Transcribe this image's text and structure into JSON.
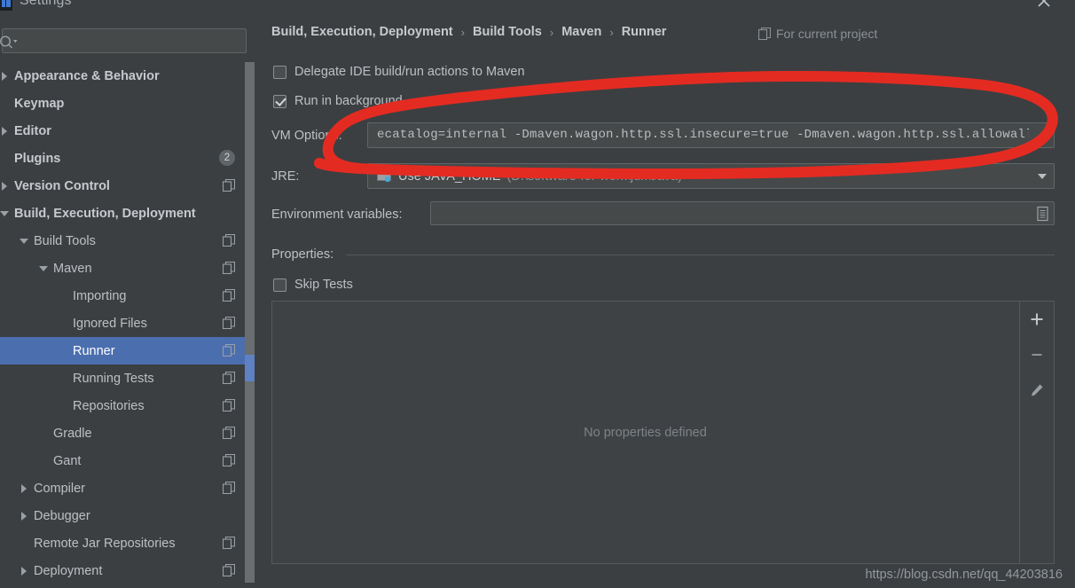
{
  "window": {
    "title": "Settings",
    "close_label": "×",
    "app_icon": "intellij-logo-icon"
  },
  "search": {
    "value": "",
    "placeholder": ""
  },
  "sidebar": {
    "items": [
      {
        "label": "Appearance & Behavior",
        "indent": 0,
        "arrow": "right",
        "bold": true,
        "badge": null,
        "copy": false,
        "selected": false
      },
      {
        "label": "Keymap",
        "indent": 0,
        "arrow": "none",
        "bold": true,
        "badge": null,
        "copy": false,
        "selected": false
      },
      {
        "label": "Editor",
        "indent": 0,
        "arrow": "right",
        "bold": true,
        "badge": null,
        "copy": false,
        "selected": false
      },
      {
        "label": "Plugins",
        "indent": 0,
        "arrow": "none",
        "bold": true,
        "badge": "2",
        "copy": false,
        "selected": false
      },
      {
        "label": "Version Control",
        "indent": 0,
        "arrow": "right",
        "bold": true,
        "badge": null,
        "copy": true,
        "selected": false
      },
      {
        "label": "Build, Execution, Deployment",
        "indent": 0,
        "arrow": "down",
        "bold": true,
        "badge": null,
        "copy": false,
        "selected": false
      },
      {
        "label": "Build Tools",
        "indent": 1,
        "arrow": "down",
        "bold": false,
        "badge": null,
        "copy": true,
        "selected": false
      },
      {
        "label": "Maven",
        "indent": 2,
        "arrow": "down",
        "bold": false,
        "badge": null,
        "copy": true,
        "selected": false
      },
      {
        "label": "Importing",
        "indent": 3,
        "arrow": "none",
        "bold": false,
        "badge": null,
        "copy": true,
        "selected": false
      },
      {
        "label": "Ignored Files",
        "indent": 3,
        "arrow": "none",
        "bold": false,
        "badge": null,
        "copy": true,
        "selected": false
      },
      {
        "label": "Runner",
        "indent": 3,
        "arrow": "none",
        "bold": false,
        "badge": null,
        "copy": true,
        "selected": true
      },
      {
        "label": "Running Tests",
        "indent": 3,
        "arrow": "none",
        "bold": false,
        "badge": null,
        "copy": true,
        "selected": false
      },
      {
        "label": "Repositories",
        "indent": 3,
        "arrow": "none",
        "bold": false,
        "badge": null,
        "copy": true,
        "selected": false
      },
      {
        "label": "Gradle",
        "indent": 2,
        "arrow": "none",
        "bold": false,
        "badge": null,
        "copy": true,
        "selected": false
      },
      {
        "label": "Gant",
        "indent": 2,
        "arrow": "none",
        "bold": false,
        "badge": null,
        "copy": true,
        "selected": false
      },
      {
        "label": "Compiler",
        "indent": 1,
        "arrow": "right",
        "bold": false,
        "badge": null,
        "copy": true,
        "selected": false
      },
      {
        "label": "Debugger",
        "indent": 1,
        "arrow": "right",
        "bold": false,
        "badge": null,
        "copy": false,
        "selected": false
      },
      {
        "label": "Remote Jar Repositories",
        "indent": 1,
        "arrow": "none",
        "bold": false,
        "badge": null,
        "copy": true,
        "selected": false
      },
      {
        "label": "Deployment",
        "indent": 1,
        "arrow": "right",
        "bold": false,
        "badge": null,
        "copy": true,
        "selected": false
      }
    ]
  },
  "breadcrumb": {
    "crumbs": [
      "Build, Execution, Deployment",
      "Build Tools",
      "Maven",
      "Runner"
    ],
    "separator": "›",
    "scope_label": "For current project"
  },
  "form": {
    "delegate_label": "Delegate IDE build/run actions to Maven",
    "delegate_checked": false,
    "run_background_label": "Run in background",
    "run_background_checked": true,
    "vm_options_label": "VM Options:",
    "vm_options_value": "ecatalog=internal -Dmaven.wagon.http.ssl.insecure=true -Dmaven.wagon.http.ssl.allowall=true",
    "jre_label": "JRE:",
    "jre_value": "Use JAVA_HOME",
    "jre_path": "(D:\\software-for-work\\jdk\\Java)",
    "env_label": "Environment variables:",
    "env_value": "",
    "properties_label": "Properties:",
    "skip_tests_label": "Skip Tests",
    "skip_tests_checked": false,
    "properties_empty_text": "No properties defined",
    "toolbar": {
      "add_label": "+",
      "remove_label": "−",
      "edit_label": "edit"
    }
  },
  "watermark": {
    "text": "https://blog.csdn.net/qq_44203816"
  },
  "colors": {
    "background": "#3c3f41",
    "selection": "#4b6eaf",
    "text": "#bcc0c4",
    "muted": "#8e9499",
    "annotation_red": "#e42b22",
    "field_bg": "#45494a"
  }
}
